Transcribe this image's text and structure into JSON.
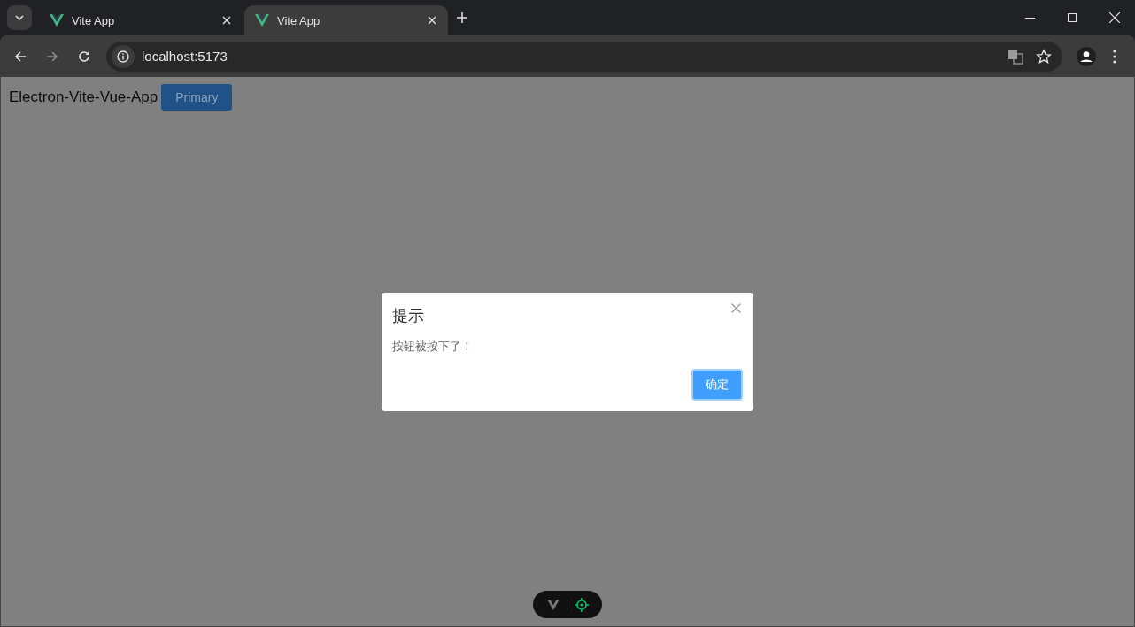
{
  "tabs": [
    {
      "title": "Vite App",
      "selected": false
    },
    {
      "title": "Vite App",
      "selected": true
    }
  ],
  "address": "localhost:5173",
  "page": {
    "heading": "Electron-Vite-Vue-App",
    "button": "Primary"
  },
  "dialog": {
    "title": "提示",
    "message": "按钮被按下了！",
    "confirm": "确定"
  }
}
